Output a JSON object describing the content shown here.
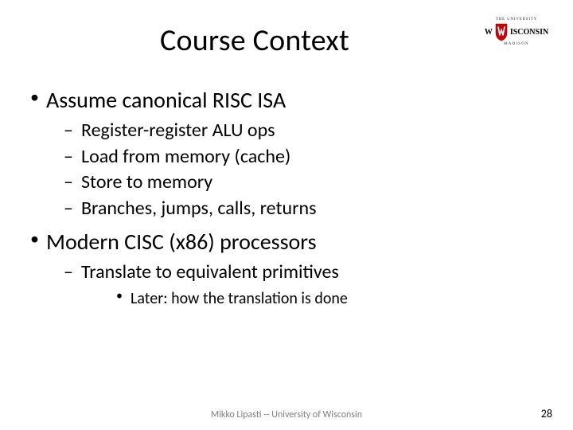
{
  "title": "Course Context",
  "logo": {
    "top": "THE UNIVERSITY",
    "left": "W",
    "right": "ISCONSIN",
    "bottom": "MADISON"
  },
  "bullets": [
    {
      "text": "Assume canonical RISC ISA",
      "children": [
        {
          "text": "Register-register ALU ops"
        },
        {
          "text": "Load from memory (cache)"
        },
        {
          "text": "Store to memory"
        },
        {
          "text": "Branches, jumps, calls, returns"
        }
      ]
    },
    {
      "text": "Modern CISC (x86) processors",
      "children": [
        {
          "text": "Translate to equivalent primitives",
          "children": [
            {
              "text": "Later: how the translation is done"
            }
          ]
        }
      ]
    }
  ],
  "footer": "Mikko Lipasti -- University of Wisconsin",
  "page_number": "28"
}
